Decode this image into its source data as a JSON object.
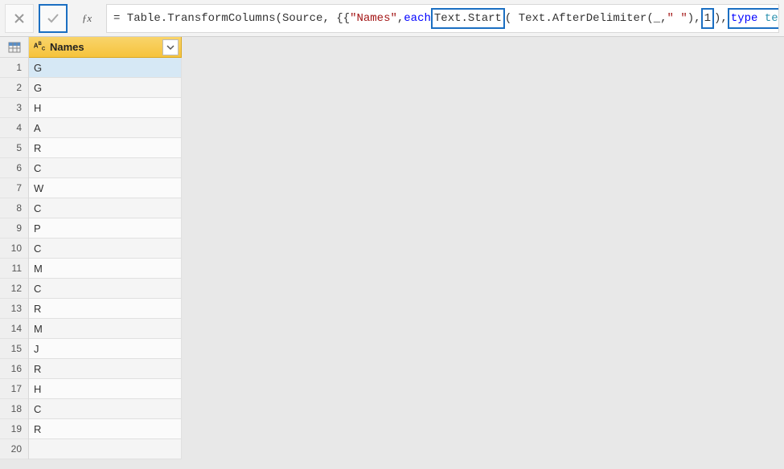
{
  "formula": {
    "prefix": "= Table.TransformColumns(Source, {{",
    "colname": "\"Names\"",
    "sep1": ", ",
    "each": "each",
    "space1": " ",
    "textstart": "Text.Start",
    "paren1": "( Text.AfterDelimiter(_, ",
    "quote_space": "\" \"",
    "sep2": "), ",
    "one": "1",
    "close1": "),",
    "space2": " ",
    "typekw": "type",
    "space3": " ",
    "typeval": "text",
    "close2": "}})"
  },
  "column": {
    "name": "Names",
    "type_label": "ABC"
  },
  "rows": [
    {
      "n": "1",
      "v": "G"
    },
    {
      "n": "2",
      "v": "G"
    },
    {
      "n": "3",
      "v": "H"
    },
    {
      "n": "4",
      "v": "A"
    },
    {
      "n": "5",
      "v": "R"
    },
    {
      "n": "6",
      "v": "C"
    },
    {
      "n": "7",
      "v": "W"
    },
    {
      "n": "8",
      "v": "C"
    },
    {
      "n": "9",
      "v": "P"
    },
    {
      "n": "10",
      "v": "C"
    },
    {
      "n": "11",
      "v": "M"
    },
    {
      "n": "12",
      "v": "C"
    },
    {
      "n": "13",
      "v": "R"
    },
    {
      "n": "14",
      "v": "M"
    },
    {
      "n": "15",
      "v": "J"
    },
    {
      "n": "16",
      "v": "R"
    },
    {
      "n": "17",
      "v": "H"
    },
    {
      "n": "18",
      "v": "C"
    },
    {
      "n": "19",
      "v": "R"
    },
    {
      "n": "20",
      "v": ""
    }
  ]
}
